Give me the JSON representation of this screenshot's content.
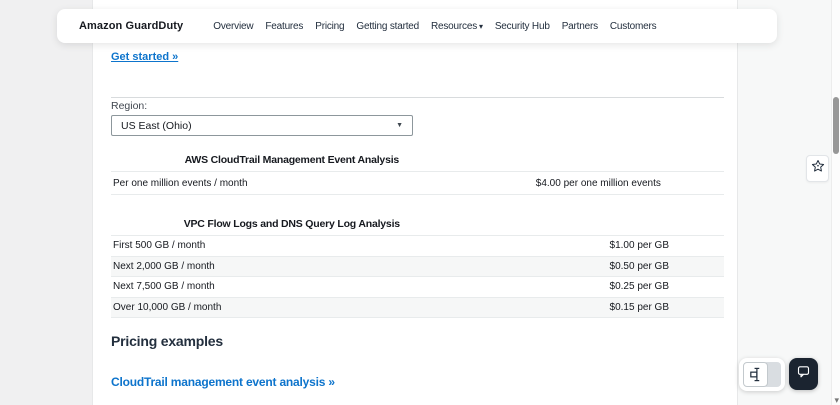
{
  "nav": {
    "brand": "Amazon GuardDuty",
    "items": [
      {
        "label": "Overview"
      },
      {
        "label": "Features"
      },
      {
        "label": "Pricing"
      },
      {
        "label": "Getting started"
      },
      {
        "label": "Resources",
        "chevron": "▾"
      },
      {
        "label": "Security Hub"
      },
      {
        "label": "Partners"
      },
      {
        "label": "Customers"
      }
    ]
  },
  "links": {
    "get_started": "Get started »",
    "example": "CloudTrail management event analysis »"
  },
  "region": {
    "label": "Region:",
    "value": "US East (Ohio)",
    "arrow": "▼"
  },
  "tables": [
    {
      "title": "AWS CloudTrail Management Event Analysis",
      "rows": [
        {
          "label": "Per one million events / month",
          "price": "$4.00 per one million events"
        }
      ]
    },
    {
      "title": "VPC Flow Logs and DNS Query Log Analysis",
      "rows": [
        {
          "label": "First 500 GB / month",
          "price": "$1.00 per GB"
        },
        {
          "label": "Next 2,000 GB / month",
          "price": "$0.50 per GB"
        },
        {
          "label": "Next 7,500 GB / month",
          "price": "$0.25 per GB"
        },
        {
          "label": "Over 10,000 GB / month",
          "price": "$0.15 per GB"
        }
      ]
    }
  ],
  "headings": {
    "pricing_examples": "Pricing examples"
  },
  "widgets": {
    "star_icon": "favorite-star-icon",
    "translate_icon": "text-tool-icon",
    "chat_icon": "chat-bubble-icon",
    "scroll_down_arrow": "▾"
  },
  "colors": {
    "accent_blue": "#0d74cc",
    "page_bg": "#f0f0f1",
    "right_bg": "#f7f8f8",
    "panel_bg": "#ffffff",
    "text_dark": "#16191f",
    "nav_text": "#232f3e",
    "divider": "#d8dbdd",
    "table_border": "#e8ebec",
    "stripe": "#f6f7f7",
    "chat_button_bg": "#1b2430",
    "scroll_thumb": "#979797"
  }
}
